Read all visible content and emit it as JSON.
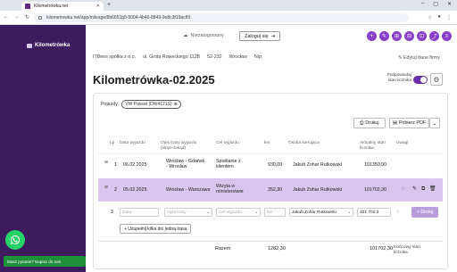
{
  "browser": {
    "tab_title": "Kilometrówka.net",
    "new_tab": "+",
    "url": "kilometrowka.net/app/mileage/8b6651b0-5004-4b46-8849-9e8c3f19ac89",
    "window_controls": [
      "–",
      "▢",
      "✕"
    ]
  },
  "sidebar": {
    "brand": "Kilometrówka",
    "chat_prompt": "Masz pytanie? Napisz do nas."
  },
  "header": {
    "status": "Niezalogowany",
    "login": "Zaloguj się",
    "action_icons": [
      "+",
      "✎",
      "⊞",
      "⊟",
      "⊡",
      "⤴",
      "≡"
    ]
  },
  "company": {
    "name": "ITBees spółka z o.o.",
    "address": "ul. Grota Roweckiego 112B",
    "postcode": "52-232",
    "city": "Wrocław",
    "nip": "Nip:",
    "edit": "Edytuj dane firmy"
  },
  "document": {
    "title": "Kilometrówka-02.2025",
    "verify_label": "Podpowiadaj stan licznika",
    "verify_on": true
  },
  "vehicles": {
    "label": "Pojazdy:",
    "selected": "VW Passat (DW4121S)"
  },
  "buttons": {
    "print": "Drukuj",
    "pdf": "Pobierz PDF",
    "add": "+ Dodaj",
    "add_trip": "+ Uzupełnij kilka dni jedną trasą"
  },
  "table": {
    "headers": {
      "lp": "Lp",
      "date": "Data wyjazdu",
      "route": "Opis trasy wyjazdu (skąd-dokąd)",
      "purpose": "Cel wyjazdu",
      "km": "km",
      "driver": "Osoba kierująca",
      "odometer": "Aktualny stan licznika",
      "notes": "Uwagi"
    },
    "rows": [
      {
        "lp": "1",
        "date": "06.02.2025",
        "route": "Wrocław - Gdańsk - Wrocław",
        "purpose": "Spotkanie z klientem",
        "km": "930,00",
        "driver": "Jakub Zohar Rutkowski",
        "odometer": "101350,00"
      },
      {
        "lp": "2",
        "date": "05.02.2025",
        "route": "Wrocław - Warszawa",
        "purpose": "Wizyta w ministerstwie",
        "km": "352,30",
        "driver": "Jakub Zohar Rutkowski",
        "odometer": "101702,30"
      }
    ],
    "new_row": {
      "lp": "3",
      "date_ph": "Data",
      "route_ph": "Opis trasy",
      "purpose_ph": "Cel wyjazdu",
      "km_ph": "km",
      "driver": "Jakub Zohar Rutkowski",
      "odometer": "101 702,3"
    },
    "summary": {
      "label": "Razem",
      "km": "1282,30",
      "odometer": "101702,30",
      "final_label": "Końcowy stan licznika"
    }
  }
}
